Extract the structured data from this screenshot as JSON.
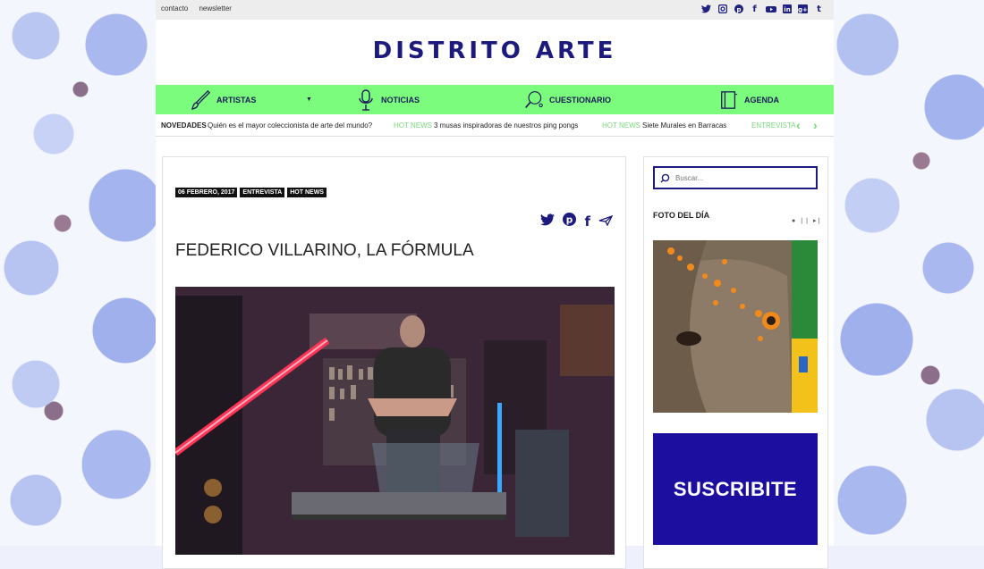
{
  "top": {
    "links": [
      "contacto",
      "newsletter"
    ],
    "social": [
      "twitter-icon",
      "instagram-icon",
      "pinterest-icon",
      "facebook-icon",
      "youtube-icon",
      "linkedin-icon",
      "googleplus-icon",
      "tumblr-icon"
    ]
  },
  "logo": "DISTRITO ARTE",
  "nav": {
    "items": [
      {
        "label": "ARTISTAS",
        "icon": "brush-icon"
      },
      {
        "label": "NOTICIAS",
        "icon": "microphone-icon"
      },
      {
        "label": "CUESTIONARIO",
        "icon": "ping-pong-icon"
      },
      {
        "label": "AGENDA",
        "icon": "book-icon"
      }
    ]
  },
  "ticker": {
    "label": "NOVEDADES",
    "items": [
      {
        "tag": "",
        "text": "Quién es el mayor coleccionista de arte del mundo?"
      },
      {
        "tag": "HOT NEWS",
        "text": "3 musas inspiradoras de nuestros ping pongs"
      },
      {
        "tag": "HOT NEWS",
        "text": "Siete Murales en Barracas"
      },
      {
        "tag": "ENTREVISTA",
        "text": ""
      }
    ]
  },
  "article": {
    "tags": [
      "06 FEBRERO, 2017",
      "ENTREVISTA",
      "HOT NEWS"
    ],
    "title": "FEDERICO VILLARINO, LA FÓRMULA"
  },
  "sidebar": {
    "search_placeholder": "Buscar...",
    "foto_label": "FOTO DEL DÍA",
    "subscribe_label": "SUSCRIBITE"
  },
  "colors": {
    "brand": "#1c1a7d",
    "nav_bg": "#7cfc7c",
    "hot_news": "#7cd87c",
    "subscribe_bg": "#1c0fa0"
  }
}
